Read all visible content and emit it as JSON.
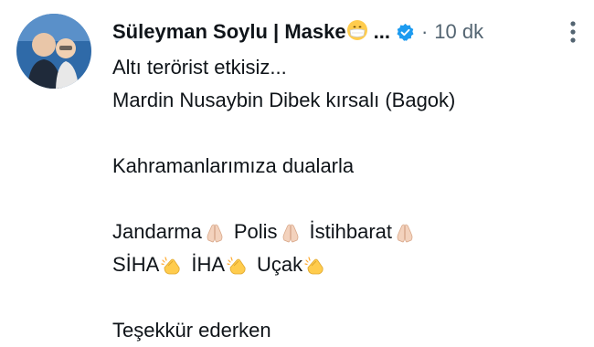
{
  "tweet": {
    "display_name": "Süleyman Soylu | Maske",
    "name_emoji": "mask-face-emoji",
    "ellipsis": "...",
    "separator": "·",
    "time": "10 dk",
    "lines": [
      "Altı terörist etkisiz...",
      "Mardin Nusaybin Dibek kırsalı (Bagok)",
      "",
      "Kahramanlarımıza dualarla",
      "",
      "Jandarma",
      "Polis",
      "İstihbarat",
      "SİHA",
      "İHA",
      "Uçak",
      "",
      "Teşekkür ederken..."
    ],
    "line_partial": "Teşekkür ederken"
  },
  "icons": {
    "verified": "verified-badge-icon",
    "more": "more-vertical-icon",
    "pray": "praying-hands-emoji",
    "clap": "clapping-hands-emoji"
  },
  "colors": {
    "text": "#0f1419",
    "muted": "#536471",
    "verified": "#1d9bf0"
  }
}
